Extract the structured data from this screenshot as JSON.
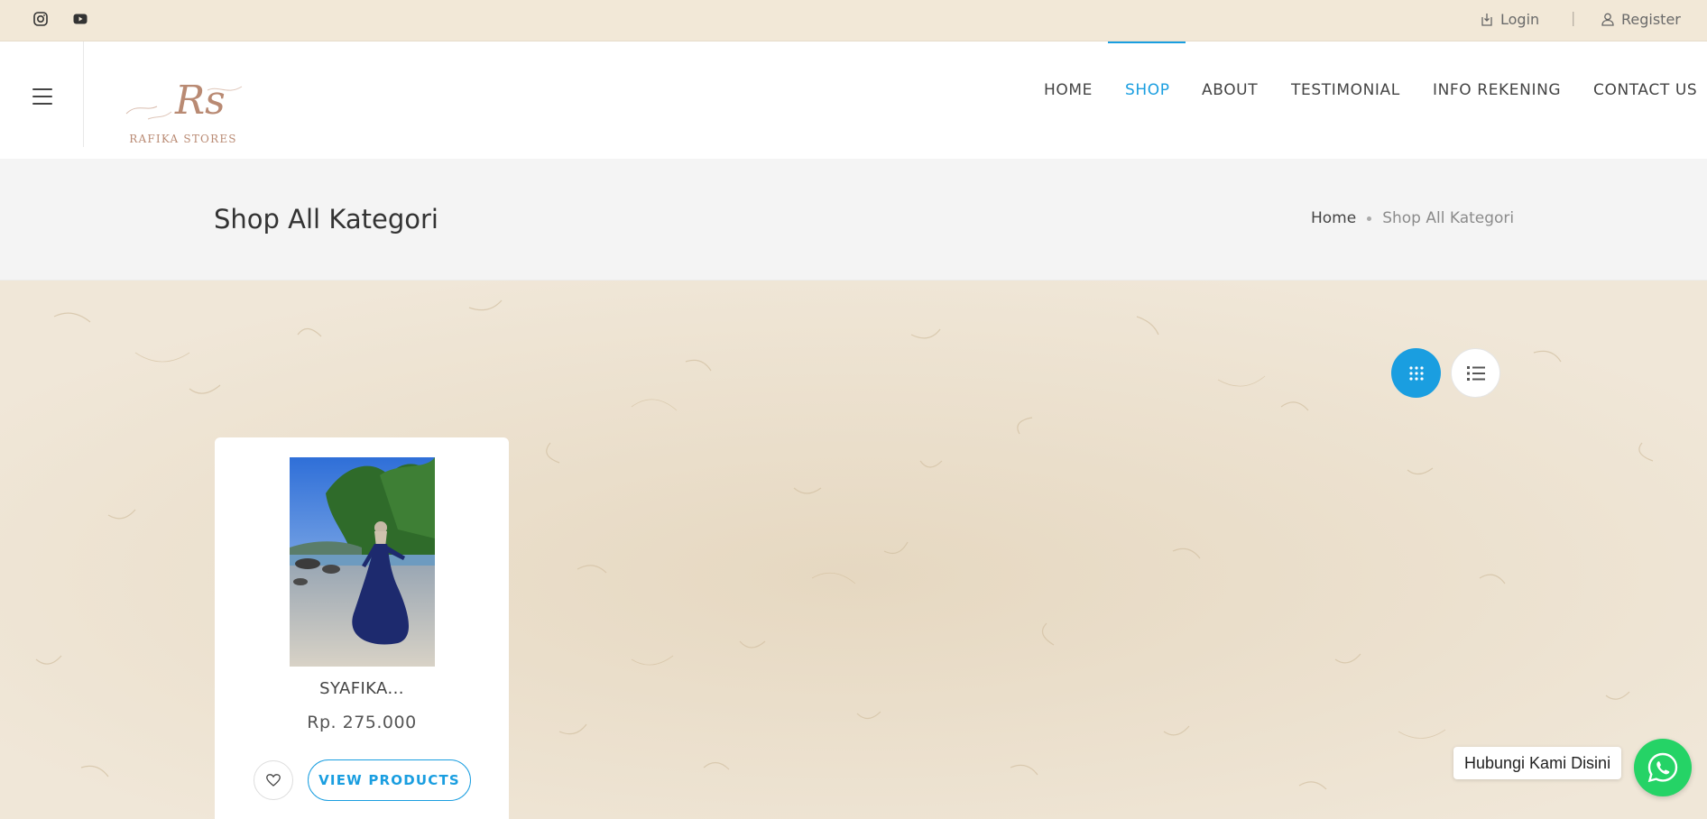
{
  "topbar": {
    "social": [
      {
        "icon": "instagram-icon"
      },
      {
        "icon": "youtube-icon"
      }
    ],
    "login_label": "Login",
    "separator": "|",
    "register_label": "Register"
  },
  "header": {
    "logo_monogram": "Rs",
    "logo_text": "RAFIKA STORES",
    "nav": [
      {
        "label": "HOME",
        "active": false
      },
      {
        "label": "SHOP",
        "active": true
      },
      {
        "label": "ABOUT",
        "active": false
      },
      {
        "label": "TESTIMONIAL",
        "active": false
      },
      {
        "label": "INFO REKENING",
        "active": false
      },
      {
        "label": "CONTACT US",
        "active": false
      }
    ]
  },
  "page": {
    "title": "Shop All Kategori",
    "breadcrumb": {
      "home": "Home",
      "current": "Shop All Kategori"
    }
  },
  "view_toggle": {
    "selected": "grid",
    "options": [
      "grid",
      "list"
    ]
  },
  "products": [
    {
      "name": "SYAFIKA...",
      "price": "Rp. 275.000",
      "cta_label": "VIEW PRODUCTS"
    }
  ],
  "whatsapp": {
    "label": "Hubungi Kami Disini"
  },
  "colors": {
    "accent": "#1a9ee0",
    "topbar_bg": "#f2e8d7",
    "title_band_bg": "#f4f4f4",
    "paper_bg": "#eadfcc",
    "whatsapp": "#25d366",
    "logo": "#b98a73"
  }
}
